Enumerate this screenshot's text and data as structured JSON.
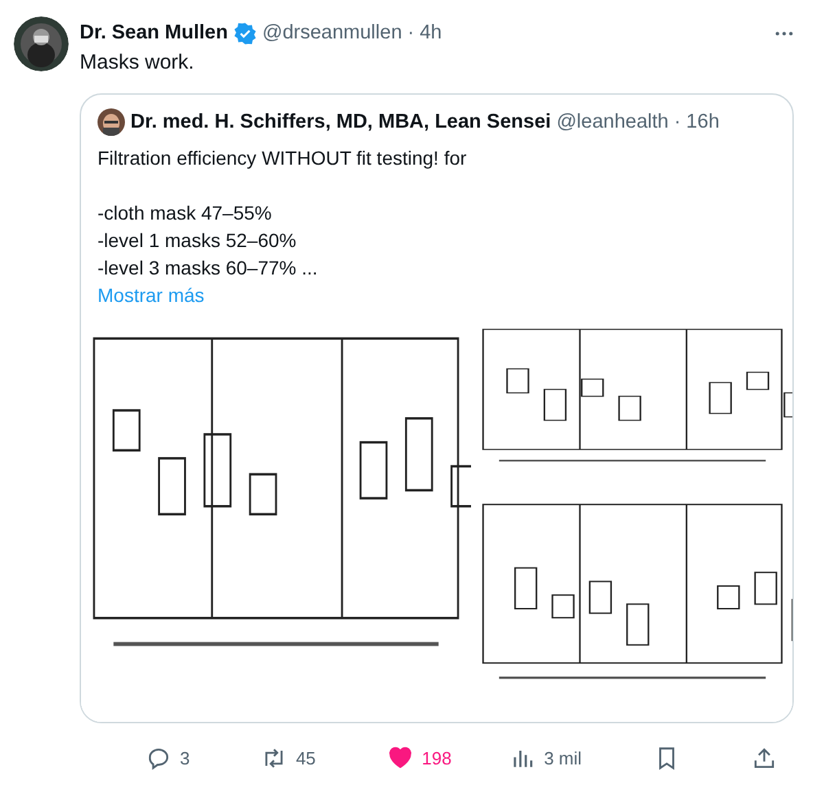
{
  "tweet": {
    "name": "Dr. Sean Mullen",
    "verified": true,
    "handle": "@drseanmullen",
    "time": "· 4h",
    "text": "Masks work."
  },
  "quote": {
    "name": "Dr. med. H. Schiffers, MD, MBA, Lean Sensei",
    "handle": "@leanhealth",
    "time": "· 16h",
    "intro": "Filtration efficiency WITHOUT fit testing! for",
    "lines": [
      "-cloth mask 47–55%",
      "-level 1 masks 52–60%",
      "-level 3 masks 60–77% ..."
    ],
    "more": "Mostrar más"
  },
  "actions": [
    {
      "kind": "reply",
      "count": "3"
    },
    {
      "kind": "retweet",
      "count": "45"
    },
    {
      "kind": "like",
      "count": "198",
      "selected": true
    },
    {
      "kind": "views",
      "count": "3 mil"
    },
    {
      "kind": "bookmark"
    },
    {
      "kind": "share"
    }
  ]
}
